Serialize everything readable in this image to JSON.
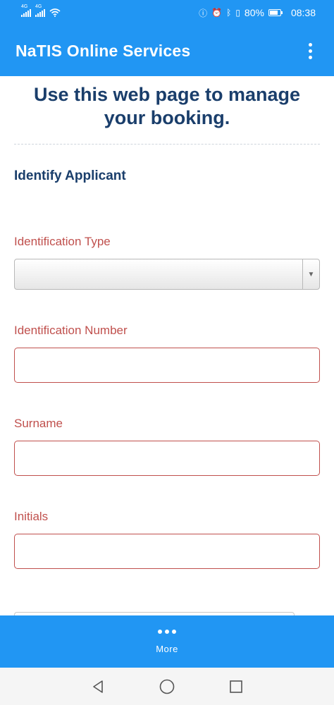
{
  "status_bar": {
    "network_1": "4G",
    "network_2": "4G",
    "battery": "80%",
    "time": "08:38"
  },
  "app_bar": {
    "title": "NaTIS Online Services",
    "menu_icon": "overflow-menu-icon"
  },
  "page": {
    "heading": "Use this web page to manage your booking.",
    "section_title": "Identify Applicant"
  },
  "form": {
    "identification_type": {
      "label": "Identification Type",
      "value": ""
    },
    "identification_number": {
      "label": "Identification Number",
      "value": ""
    },
    "surname": {
      "label": "Surname",
      "value": ""
    },
    "initials": {
      "label": "Initials",
      "value": ""
    }
  },
  "bottom_bar": {
    "more_label": "More",
    "icon": "more-dots-icon"
  },
  "colors": {
    "primary": "#2196f3",
    "heading": "#1a3e6b",
    "error": "#c0504d"
  },
  "nav_bar": {
    "icons": [
      "back-icon",
      "home-icon",
      "recents-icon"
    ]
  }
}
